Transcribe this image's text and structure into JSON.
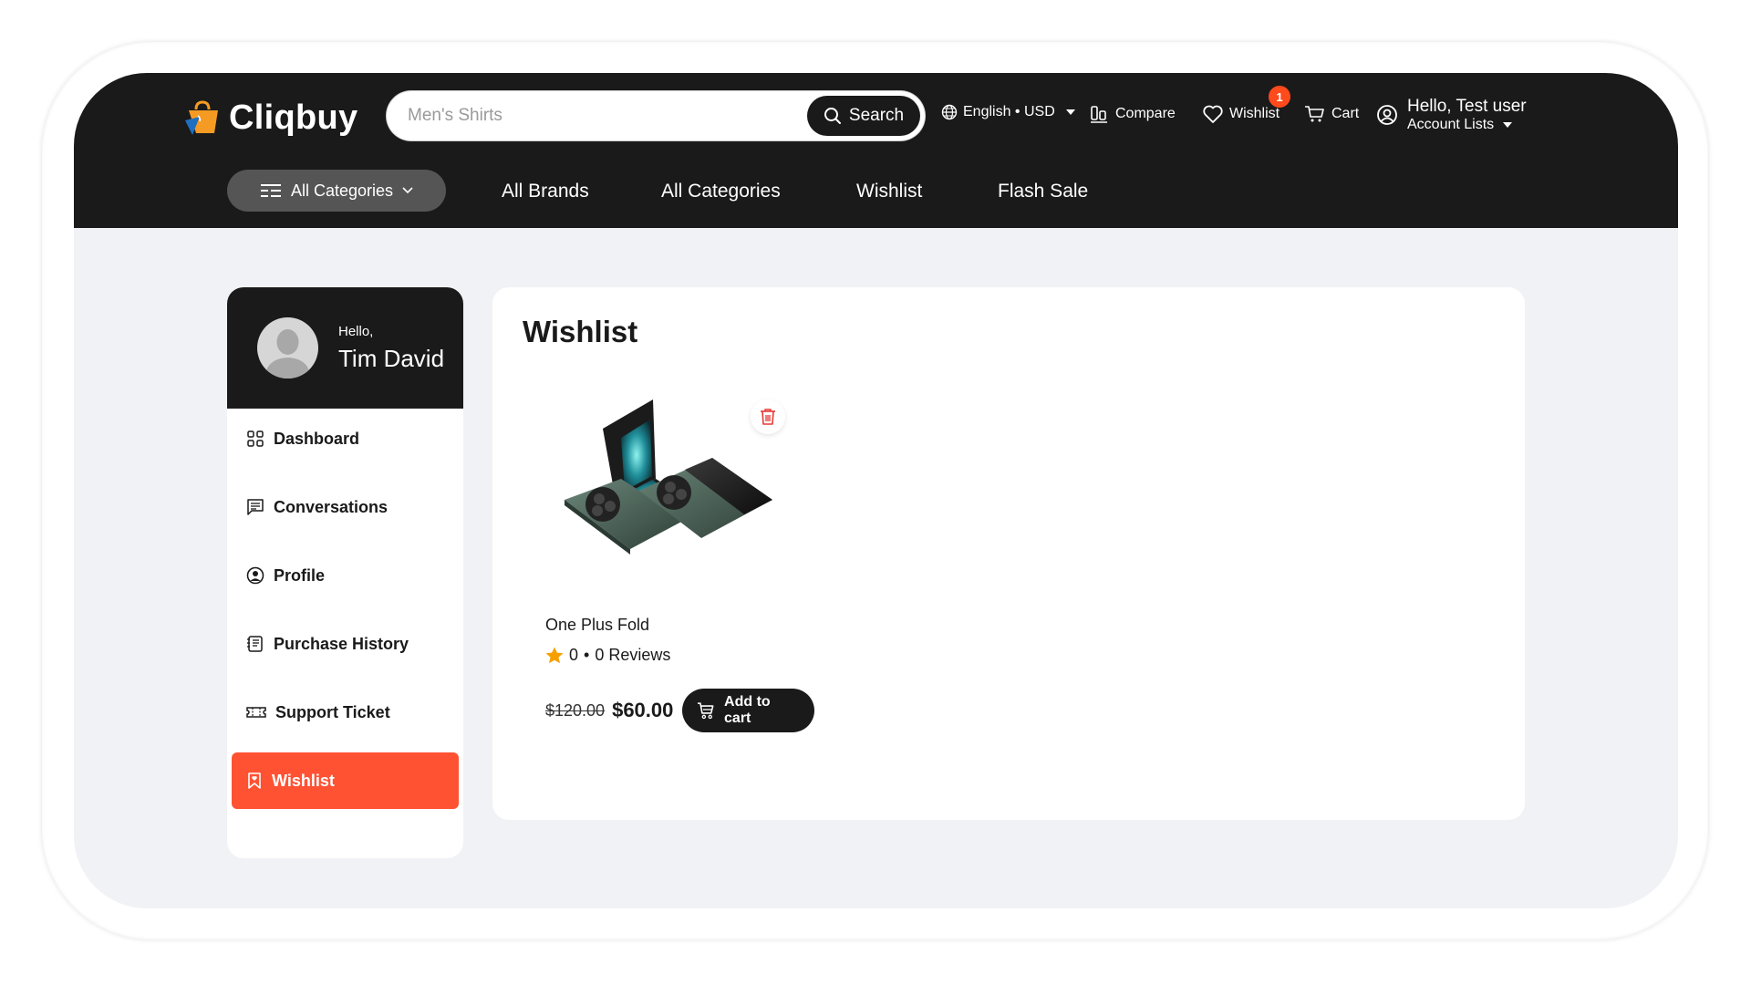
{
  "brand": {
    "name": "Cliqbuy",
    "accent": "#ff5233",
    "logo_orange": "#f59b23",
    "logo_blue": "#1f6fc1"
  },
  "header": {
    "search": {
      "placeholder": "Men's Shirts",
      "value": "",
      "button_label": "Search"
    },
    "language_currency": "English • USD",
    "compare_label": "Compare",
    "wishlist_label": "Wishlist",
    "wishlist_count": "1",
    "cart_label": "Cart",
    "account_greeting": "Hello, Test user",
    "account_lists_label": "Account Lists"
  },
  "nav": {
    "categories_button": "All Categories",
    "links": [
      "All Brands",
      "All Categories",
      "Wishlist",
      "Flash Sale"
    ]
  },
  "sidebar": {
    "greeting": "Hello,",
    "user_name": "Tim David",
    "items": [
      {
        "label": "Dashboard",
        "icon": "grid-icon",
        "active": false
      },
      {
        "label": "Conversations",
        "icon": "chat-icon",
        "active": false
      },
      {
        "label": "Profile",
        "icon": "user-circle-icon",
        "active": false
      },
      {
        "label": "Purchase History",
        "icon": "receipt-icon",
        "active": false
      },
      {
        "label": "Support Ticket",
        "icon": "ticket-icon",
        "active": false
      },
      {
        "label": "Wishlist",
        "icon": "bookmark-heart-icon",
        "active": true
      }
    ]
  },
  "main": {
    "title": "Wishlist",
    "products": [
      {
        "name": "One Plus Fold",
        "rating": "0",
        "reviews": "0 Reviews",
        "old_price": "$120.00",
        "price": "$60.00",
        "add_to_cart_label": "Add to cart"
      }
    ]
  }
}
